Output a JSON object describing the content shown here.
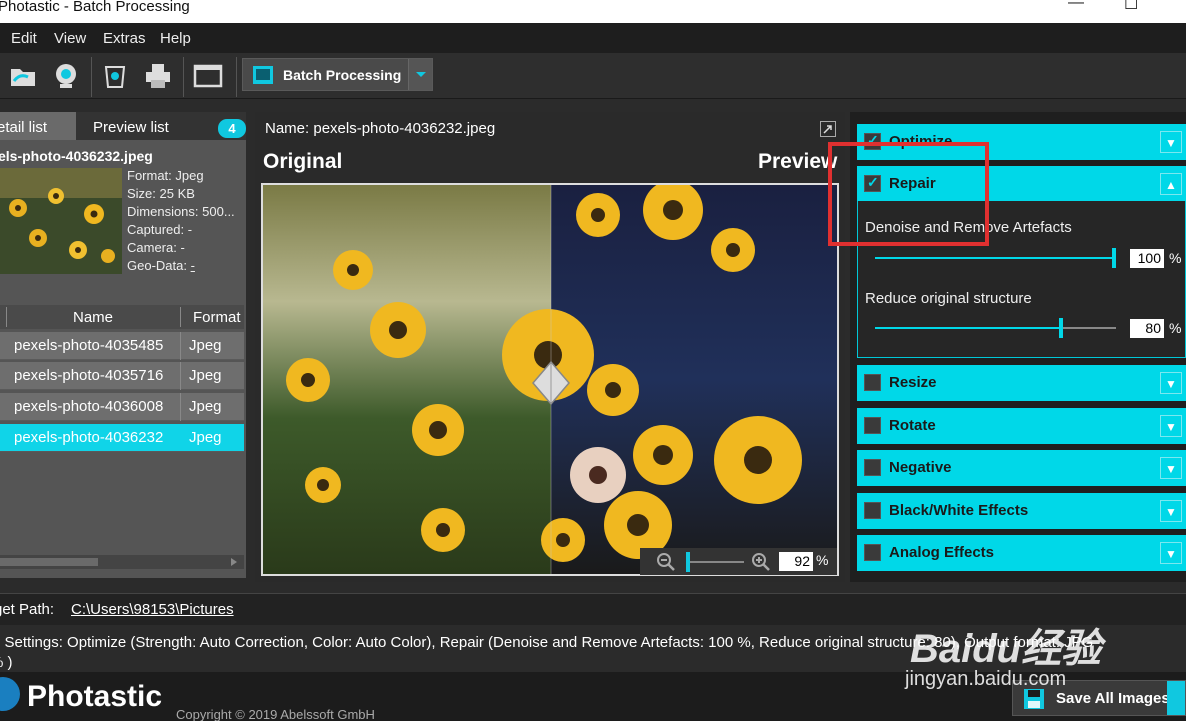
{
  "window": {
    "title": "Photastic - Batch Processing",
    "minimize": "—",
    "maximize": "☐"
  },
  "menu": {
    "items": [
      "Edit",
      "View",
      "Extras",
      "Help"
    ]
  },
  "toolbar": {
    "batch_label": "Batch Processing",
    "icons": [
      "open-folder-icon",
      "webcam-icon",
      "recycle-bin-icon",
      "printer-icon",
      "window-icon"
    ]
  },
  "left": {
    "tab_detail": "etail list",
    "tab_preview": "Preview list",
    "count": "4",
    "selected_file": "els-photo-4036232.jpeg",
    "meta": {
      "format": "Format: Jpeg",
      "size": "Size: 25 KB",
      "dimensions": "Dimensions: 500...",
      "captured": "Captured: -",
      "camera": "Camera: -",
      "geo_label": "Geo-Data:",
      "geo_value": "-"
    },
    "table": {
      "col_name": "Name",
      "col_format": "Format",
      "rows": [
        {
          "name": "pexels-photo-4035485",
          "format": "Jpeg"
        },
        {
          "name": "pexels-photo-4035716",
          "format": "Jpeg"
        },
        {
          "name": "pexels-photo-4036008",
          "format": "Jpeg"
        },
        {
          "name": "pexels-photo-4036232",
          "format": "Jpeg"
        }
      ]
    }
  },
  "center": {
    "name_label": "Name: pexels-photo-4036232.jpeg",
    "original": "Original",
    "preview": "Preview",
    "zoom_value": "92",
    "zoom_unit": "%"
  },
  "right": {
    "sections": {
      "optimize": "Optimize",
      "repair": "Repair",
      "resize": "Resize",
      "rotate": "Rotate",
      "negative": "Negative",
      "bw": "Black/White Effects",
      "analog": "Analog Effects"
    },
    "repair": {
      "denoise_label": "Denoise and Remove Artefacts",
      "denoise_value": "100",
      "denoise_fraction": 1.0,
      "structure_label": "Reduce original structure",
      "structure_value": "80",
      "structure_fraction": 0.8,
      "unit": "%"
    }
  },
  "bottom": {
    "target_label": "get Path:",
    "target_path": "C:\\Users\\98153\\Pictures",
    "settings_line1": "d Settings: Optimize (Strength: Auto Correction, Color: Auto Color), Repair (Denoise and Remove Artefacts: 100 %, Reduce original structure: 80), Output format: JPG",
    "settings_line2": "% )",
    "brand": "Photastic",
    "copyright": "Copyright © 2019 Abelssoft GmbH",
    "save_label": "Save All Images"
  },
  "watermark": {
    "big": "Baidu经验",
    "small": "jingyan.baidu.com"
  },
  "colors": {
    "accent": "#00d8e8",
    "highlight_box": "#e03030"
  }
}
